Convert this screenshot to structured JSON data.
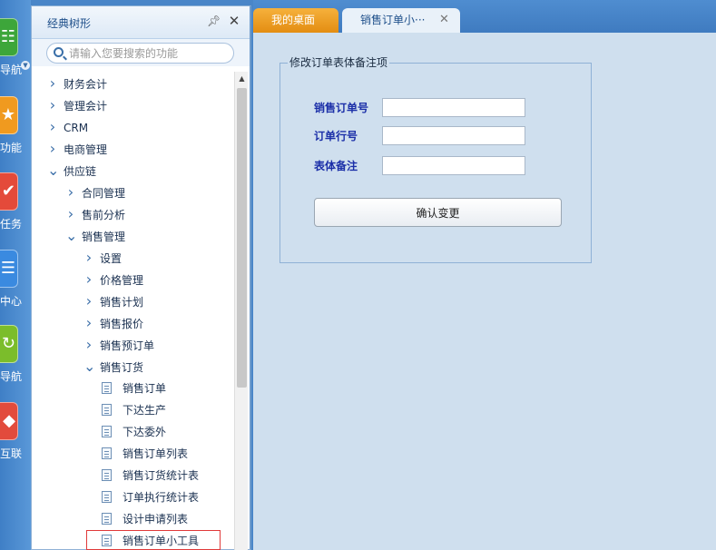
{
  "rail": {
    "items": [
      {
        "label": "导航",
        "icon": "grid-icon",
        "color": "#3da63a"
      },
      {
        "label": "功能",
        "icon": "star-icon",
        "color": "#f09a1f"
      },
      {
        "label": "任务",
        "icon": "checkmark-icon",
        "color": "#e44a3a"
      },
      {
        "label": "中心",
        "icon": "document-icon",
        "color": "#3a8ae0"
      },
      {
        "label": "导航",
        "icon": "refresh-icon",
        "color": "#7bbd2b"
      },
      {
        "label": "互联",
        "icon": "network-icon",
        "color": "#e24b3c"
      }
    ]
  },
  "tree": {
    "title": "经典树形",
    "search_placeholder": "请输入您要搜索的功能",
    "nodes": [
      {
        "label": "财务会计",
        "type": "collapsed"
      },
      {
        "label": "管理会计",
        "type": "collapsed"
      },
      {
        "label": "CRM",
        "type": "collapsed"
      },
      {
        "label": "电商管理",
        "type": "collapsed"
      },
      {
        "label": "供应链",
        "type": "expanded"
      },
      {
        "label": "合同管理",
        "type": "collapsed"
      },
      {
        "label": "售前分析",
        "type": "collapsed"
      },
      {
        "label": "销售管理",
        "type": "expanded"
      },
      {
        "label": "设置",
        "type": "collapsed"
      },
      {
        "label": "价格管理",
        "type": "collapsed"
      },
      {
        "label": "销售计划",
        "type": "collapsed"
      },
      {
        "label": "销售报价",
        "type": "collapsed"
      },
      {
        "label": "销售预订单",
        "type": "collapsed"
      },
      {
        "label": "销售订货",
        "type": "expanded"
      },
      {
        "label": "销售订单",
        "type": "leaf"
      },
      {
        "label": "下达生产",
        "type": "leaf"
      },
      {
        "label": "下达委外",
        "type": "leaf"
      },
      {
        "label": "销售订单列表",
        "type": "leaf"
      },
      {
        "label": "销售订货统计表",
        "type": "leaf"
      },
      {
        "label": "订单执行统计表",
        "type": "leaf"
      },
      {
        "label": "设计申请列表",
        "type": "leaf"
      },
      {
        "label": "销售订单小工具",
        "type": "leaf",
        "selected": true
      }
    ]
  },
  "tabs": [
    {
      "label": "我的桌面",
      "active": false
    },
    {
      "label": "销售订单小···",
      "active": true
    }
  ],
  "form": {
    "legend": "修改订单表体备注项",
    "fields": [
      {
        "label": "销售订单号",
        "value": ""
      },
      {
        "label": "订单行号",
        "value": ""
      },
      {
        "label": "表体备注",
        "value": ""
      }
    ],
    "confirm_label": "确认变更"
  },
  "colors": {
    "accent": "#4a86c8",
    "tab_active_orange": "#f0a22a",
    "label_blue": "#1b2fa8",
    "content_bg": "#cfdfee",
    "selected_border": "#e03a3a"
  }
}
